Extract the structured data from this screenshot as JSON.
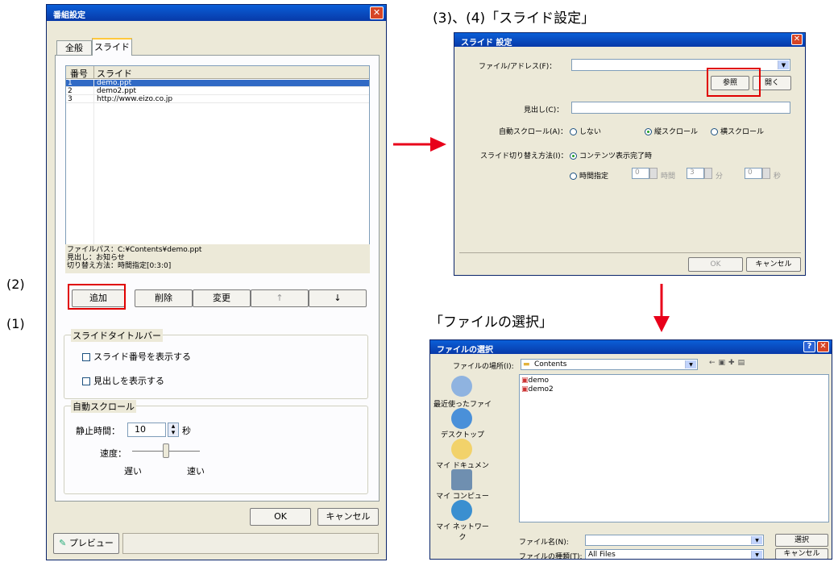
{
  "labels": {
    "n1": "(1)",
    "n2": "(2)",
    "n34": "(3)、(4)「スライド設定」",
    "file_select": "「ファイルの選択」"
  },
  "main": {
    "title": "番組設定",
    "tabs": [
      "全般",
      "スライド"
    ],
    "list": {
      "headers": [
        "番号",
        "スライド"
      ],
      "rows": [
        {
          "num": "1",
          "name": "demo.ppt"
        },
        {
          "num": "2",
          "name": "demo2.ppt"
        },
        {
          "num": "3",
          "name": "http://www.eizo.co.jp"
        }
      ]
    },
    "info": [
      "ファイルパス：C:¥Contents¥demo.ppt",
      "見出し：お知らせ",
      "切り替え方法：時間指定[0:3:0]"
    ],
    "buttons": {
      "add": "追加",
      "delete": "削除",
      "change": "変更",
      "up": "↑",
      "down": "↓"
    },
    "titlebar_group": "スライドタイトルバー",
    "show_num": "スライド番号を表示する",
    "show_heading": "見出しを表示する",
    "scroll_group": "自動スクロール",
    "stop_label": "静止時間：",
    "stop_value": "10",
    "sec": "秒",
    "speed_label": "速度：",
    "slow": "遅い",
    "fast": "速い",
    "ok": "OK",
    "cancel": "キャンセル",
    "preview": "プレビュー"
  },
  "slide": {
    "title": "スライド 設定",
    "file_label": "ファイル/アドレス(F)：",
    "browse": "参照",
    "open": "開く",
    "heading_label": "見出し(C)：",
    "scroll_label": "自動スクロール(A)：",
    "opt_none": "しない",
    "opt_vertical": "縦スクロール",
    "opt_horizontal": "横スクロール",
    "switch_label": "スライド切り替え方法(I)：",
    "opt_content": "コンテンツ表示完了時",
    "opt_time": "時間指定",
    "h": "0",
    "hour": "時間",
    "m": "3",
    "min": "分",
    "s": "0",
    "sec": "秒",
    "ok": "OK",
    "cancel": "キャンセル"
  },
  "file": {
    "title": "ファイルの選択",
    "lookin_label": "ファイルの場所(I):",
    "folder": "Contents",
    "places": [
      "最近使ったファイル",
      "デスクトップ",
      "マイ ドキュメント",
      "マイ コンピュータ",
      "マイ ネットワーク"
    ],
    "files": [
      "demo",
      "demo2"
    ],
    "name_label": "ファイル名(N):",
    "type_label": "ファイルの種類(T):",
    "type_value": "All Files",
    "select": "選択",
    "cancel": "キャンセル"
  }
}
